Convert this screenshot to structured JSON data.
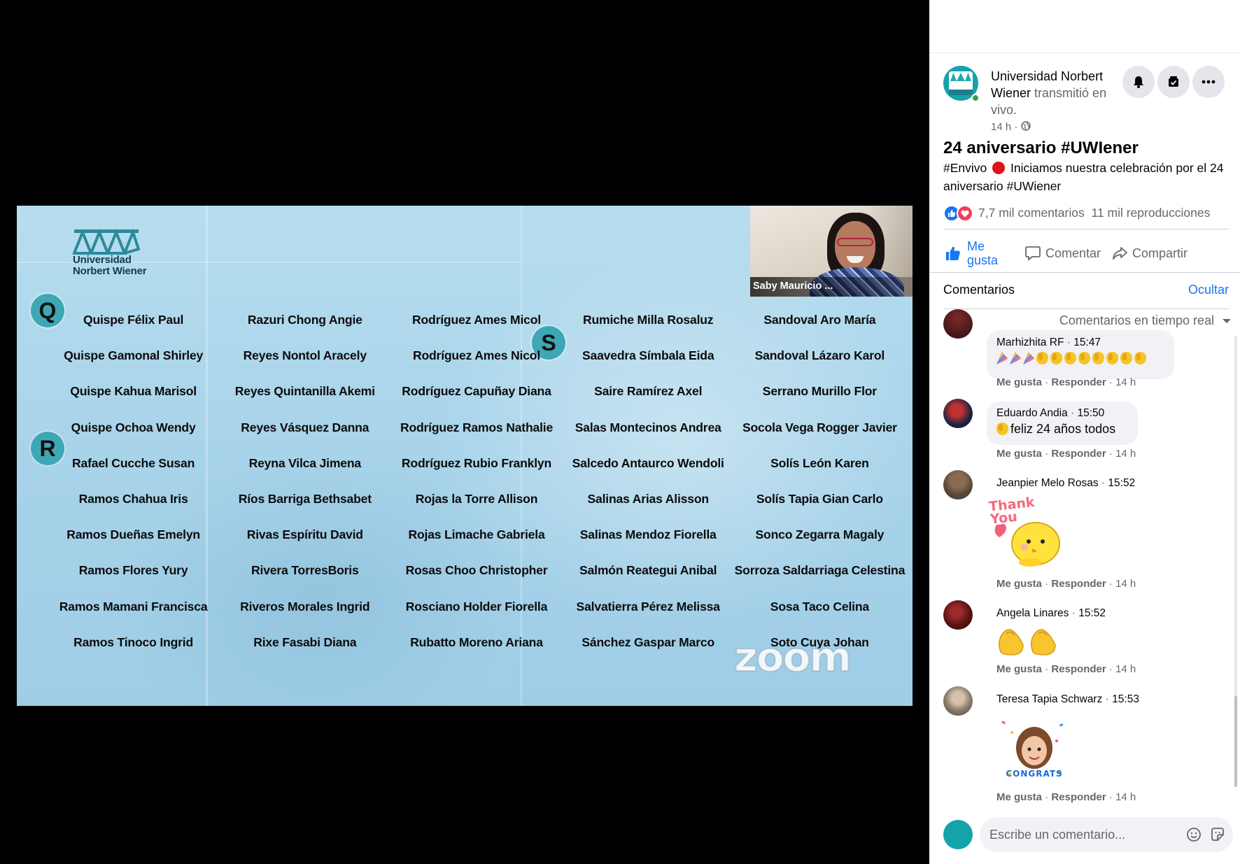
{
  "video": {
    "university_logo": {
      "line1": "Universidad",
      "line2": "Norbert Wiener"
    },
    "letters": {
      "q": "Q",
      "r": "R",
      "s": "S"
    },
    "names": [
      [
        "Quispe Félix Paul",
        "Razuri Chong Angie",
        "Rodríguez Ames Micol",
        "Rumiche Milla Rosaluz",
        "Sandoval Aro María"
      ],
      [
        "Quispe Gamonal Shirley",
        "Reyes Nontol Aracely",
        "Rodríguez Ames Nicol",
        "Saavedra Símbala Eida",
        "Sandoval Lázaro Karol"
      ],
      [
        "Quispe Kahua Marisol",
        "Reyes Quintanilla Akemi",
        "Rodríguez Capuñay Diana",
        "Saire Ramírez Axel",
        "Serrano Murillo Flor"
      ],
      [
        "Quispe Ochoa Wendy",
        "Reyes Vásquez Danna",
        "Rodríguez Ramos Nathalie",
        "Salas Montecinos Andrea",
        "Socola Vega Rogger Javier"
      ],
      [
        "Rafael Cucche Susan",
        "Reyna Vilca Jimena",
        "Rodríguez Rubio Franklyn",
        "Salcedo Antaurco Wendoli",
        "Solís León Karen"
      ],
      [
        "Ramos Chahua Iris",
        "Ríos Barriga Bethsabet",
        "Rojas la Torre Allison",
        "Salinas Arias Alisson",
        "Solís Tapia Gian Carlo"
      ],
      [
        "Ramos Dueñas Emelyn",
        "Rivas Espíritu David",
        "Rojas Limache Gabriela",
        "Salinas Mendoz Fiorella",
        "Sonco Zegarra Magaly"
      ],
      [
        "Ramos Flores Yury",
        "Rivera TorresBoris",
        "Rosas Choo Christopher",
        "Salmón Reategui Anibal",
        "Sorroza Saldarriaga Celestina"
      ],
      [
        "Ramos Mamani Francisca",
        "Riveros Morales Ingrid",
        "Rosciano Holder Fiorella",
        "Salvatierra Pérez Melissa",
        "Sosa Taco Celina"
      ],
      [
        "Ramos Tinoco Ingrid",
        "Rixe Fasabi Diana",
        "Rubatto Moreno Ariana",
        "Sánchez Gaspar Marco",
        "Soto Cuya Johan"
      ]
    ],
    "participant_name": "Saby Mauricio ...",
    "zoom_watermark": "zoom"
  },
  "post": {
    "page_name": "Universidad Norbert Wiener",
    "action_text": "transmitió en vivo.",
    "time": "14 h",
    "time_separator": "·",
    "globe_icon": "globe-icon",
    "title": "24 aniversario #UWIener",
    "body_hashtag": "#Envivo",
    "body_text": "Iniciamos nuestra celebración por el 24 aniversario #UWiener",
    "comments_count": "7,7 mil comentarios",
    "views_count": "11 mil reproducciones",
    "like_label": "Me gusta",
    "comment_label": "Comentar",
    "share_label": "Compartir"
  },
  "comments_section": {
    "label": "Comentarios",
    "hide_link": "Ocultar",
    "sort_label": "Comentarios en tiempo real",
    "input_placeholder": "Escribe un comentario..."
  },
  "comments": [
    {
      "author": "Marhizhita RF",
      "time": "15:47",
      "like": "Me gusta",
      "reply": "Responder",
      "age": "14 h"
    },
    {
      "author": "Eduardo Andia",
      "time": "15:50",
      "text": "feliz 24 años todos",
      "like": "Me gusta",
      "reply": "Responder",
      "age": "14 h"
    },
    {
      "author": "Jeanpier Melo Rosas",
      "time": "15:52",
      "sticker_text": "Thank You",
      "like": "Me gusta",
      "reply": "Responder",
      "age": "14 h"
    },
    {
      "author": "Angela Linares",
      "time": "15:52",
      "like": "Me gusta",
      "reply": "Responder",
      "age": "14 h"
    },
    {
      "author": "Teresa Tapia Schwarz",
      "time": "15:53",
      "sticker_text": "CONGRATS",
      "like": "Me gusta",
      "reply": "Responder",
      "age": "14 h"
    }
  ],
  "colors": {
    "facebook_blue": "#1877f2",
    "love_red": "#f33e58",
    "video_bg": "#a9d4ea",
    "badge_teal": "#3ea7b5"
  }
}
